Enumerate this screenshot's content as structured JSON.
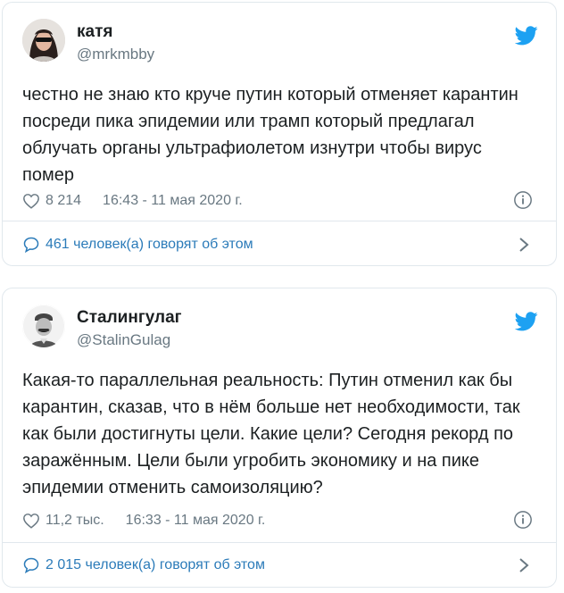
{
  "tweets": [
    {
      "name": "катя",
      "handle": "@mrkmbby",
      "text": "честно не знаю кто круче путин который отменяет карантин посреди пика эпидемии или трамп который предлагал облучать органы ультрафиолетом изнутри чтобы вирус помер",
      "likes": "8 214",
      "timestamp": "16:43 - 11 мая 2020 г.",
      "conversation": "461 человек(а) говорят об этом"
    },
    {
      "name": "Сталингулаг",
      "handle": "@StalinGulag",
      "text": "Какая-то параллельная реальность: Путин отменил как бы карантин, сказав, что в нём больше нет необходимости, так как были достигнуты цели. Какие цели? Сегодня рекорд по заражённым. Цели были угробить экономику и на пике эпидемии отменить самоизоляцию?",
      "likes": "11,2 тыс.",
      "timestamp": "16:33 - 11 мая 2020 г.",
      "conversation": "2 015 человек(а) говорят об этом"
    }
  ],
  "colors": {
    "twitter_blue": "#1da1f2",
    "link_blue": "#2b7bb9",
    "muted": "#697882",
    "border": "#e1e8ed"
  },
  "icons": {
    "brand": "twitter-bird-icon",
    "like": "heart-icon",
    "info": "info-icon",
    "reply": "speech-bubble-icon",
    "more": "chevron-right-icon"
  }
}
